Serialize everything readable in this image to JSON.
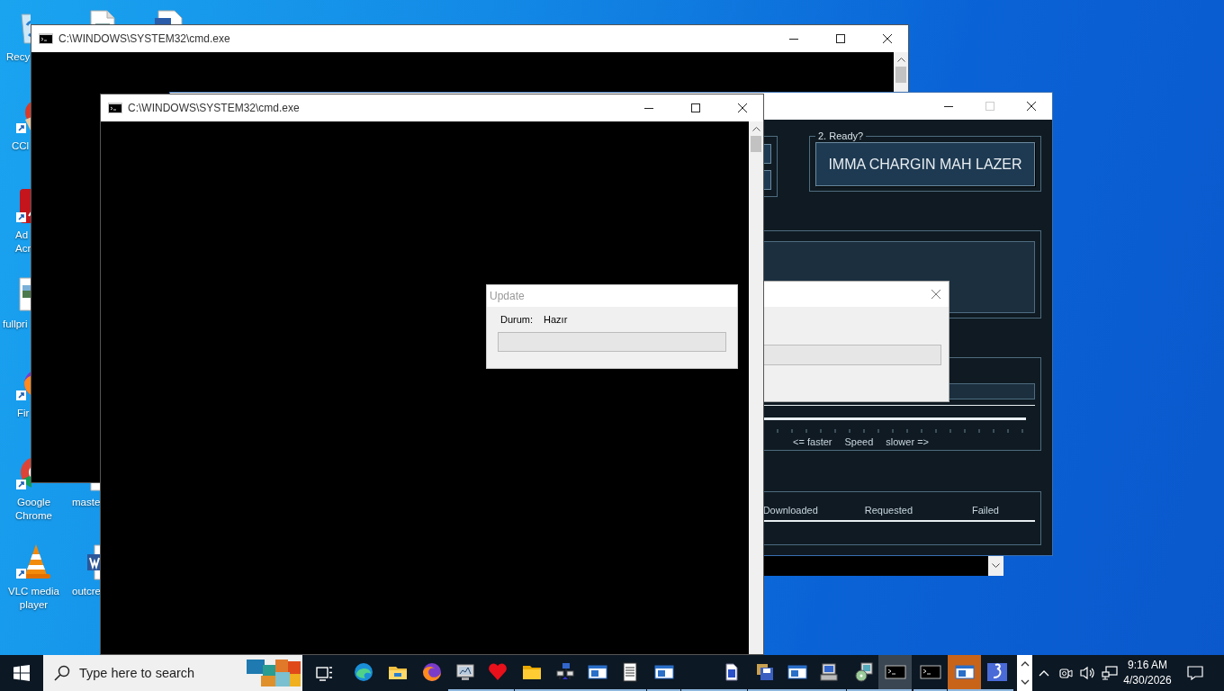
{
  "desktop_icons": [
    {
      "kind": "recycle",
      "label": "Recy"
    },
    {
      "kind": "doc"
    },
    {
      "kind": "docblue"
    },
    {
      "kind": "brush",
      "label": "CCl"
    },
    {
      "kind": "app",
      "label": "Ad\nAcr"
    },
    {
      "kind": "image",
      "label": "fullpri"
    },
    {
      "kind": "fox",
      "label": "Fir"
    },
    {
      "kind": "chrome",
      "label": "Google\nChrome"
    },
    {
      "kind": "file",
      "label": "maste"
    },
    {
      "kind": "cone",
      "label": "VLC media\nplayer"
    },
    {
      "kind": "word",
      "label": "outcre"
    }
  ],
  "console_back": {
    "title": "C:\\WINDOWS\\SYSTEM32\\cmd.exe"
  },
  "loic": {
    "maximize_disabled": true,
    "ready_group": {
      "legend": "2. Ready?",
      "button": "IMMA CHARGIN MAH LAZER"
    },
    "speed": {
      "labels": [
        "<= faster",
        "Speed",
        "slower =>"
      ]
    },
    "stats": {
      "columns": [
        "Downloaded",
        "Requested",
        "Failed"
      ]
    }
  },
  "hidden_dialog": {
    "progress": {
      "level": 0
    }
  },
  "console_front": {
    "title": "C:\\WINDOWS\\SYSTEM32\\cmd.exe"
  },
  "update_dialog": {
    "title": "Update",
    "active": false,
    "status_label": "Durum:",
    "status_value": "Hazır",
    "progress": {
      "level": 0
    }
  },
  "taskbar": {
    "search_placeholder": "Type here to search",
    "apps": [
      {
        "running": false,
        "active": false,
        "flashing": false
      },
      {
        "running": false,
        "active": false,
        "flashing": false
      },
      {
        "running": false,
        "active": false,
        "flashing": false
      },
      {
        "running": true,
        "active": false,
        "flashing": false
      },
      {
        "running": true,
        "active": false,
        "flashing": false
      },
      {
        "running": true,
        "active": false,
        "flashing": false
      },
      {
        "running": true,
        "active": false,
        "flashing": false
      },
      {
        "running": true,
        "active": false,
        "flashing": false
      },
      {
        "running": true,
        "active": false,
        "flashing": false
      },
      {
        "running": true,
        "active": false,
        "flashing": false
      },
      {
        "running": true,
        "active": false,
        "flashing": false
      },
      {
        "running": true,
        "active": false,
        "flashing": false
      },
      {
        "running": true,
        "active": false,
        "flashing": false
      },
      {
        "running": true,
        "active": false,
        "flashing": false
      },
      {
        "running": true,
        "active": false,
        "flashing": false
      },
      {
        "running": true,
        "active": false,
        "flashing": false
      },
      {
        "running": true,
        "active": true,
        "flashing": false
      },
      {
        "running": true,
        "active": false,
        "flashing": false
      },
      {
        "running": true,
        "active": false,
        "flashing": true
      },
      {
        "running": true,
        "active": false,
        "flashing": false
      }
    ],
    "clock": {
      "time": "9:16 AM",
      "date": "4/30/2026"
    }
  }
}
